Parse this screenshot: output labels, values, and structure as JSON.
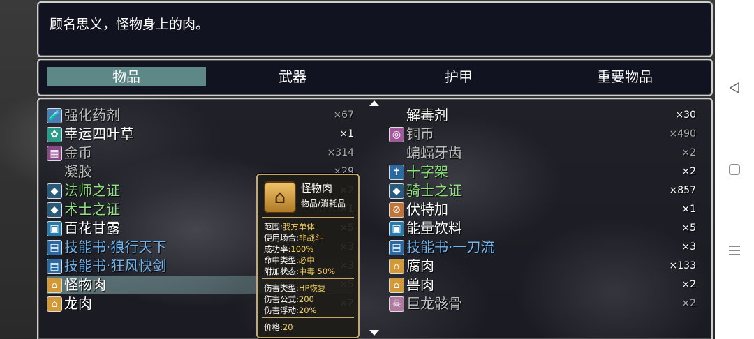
{
  "help_text": "顾名思义，怪物身上的肉。",
  "tabs": [
    {
      "label": "物品",
      "active": true
    },
    {
      "label": "武器",
      "active": false
    },
    {
      "label": "护甲",
      "active": false
    },
    {
      "label": "重要物品",
      "active": false
    }
  ],
  "items_left": [
    {
      "name": "强化药剂",
      "count": "×67",
      "icon": "potion-icon",
      "style": "dim"
    },
    {
      "name": "幸运四叶草",
      "count": "×1",
      "icon": "clover-icon",
      "style": ""
    },
    {
      "name": "金币",
      "count": "×314",
      "icon": "gold-coin-icon",
      "style": "dim"
    },
    {
      "name": "凝胶",
      "count": "×29",
      "icon": "",
      "style": "dim"
    },
    {
      "name": "法师之证",
      "count": "×2",
      "icon": "mage-badge-icon",
      "style": "green"
    },
    {
      "name": "术士之证",
      "count": "×1",
      "icon": "warlock-badge-icon",
      "style": "green"
    },
    {
      "name": "百花甘露",
      "count": "×5",
      "icon": "nectar-jar-icon",
      "style": ""
    },
    {
      "name": "技能书·狼行天下",
      "count": "×3",
      "icon": "skill-book-icon",
      "style": "blue"
    },
    {
      "name": "技能书·狂风快剑",
      "count": "×3",
      "icon": "skill-book-icon",
      "style": "blue"
    },
    {
      "name": "怪物肉",
      "count": "×5",
      "icon": "meat-icon",
      "style": ""
    },
    {
      "name": "龙肉",
      "count": "×2",
      "icon": "meat-icon",
      "style": ""
    }
  ],
  "items_right": [
    {
      "name": "解毒剂",
      "count": "×30",
      "icon": "",
      "style": ""
    },
    {
      "name": "铜币",
      "count": "×490",
      "icon": "copper-coin-icon",
      "style": "dim"
    },
    {
      "name": "蝙蝠牙齿",
      "count": "×2",
      "icon": "",
      "style": "dim"
    },
    {
      "name": "十字架",
      "count": "×2",
      "icon": "cross-icon",
      "style": "green"
    },
    {
      "name": "骑士之证",
      "count": "×857",
      "icon": "knight-badge-icon",
      "style": "green"
    },
    {
      "name": "伏特加",
      "count": "×1",
      "icon": "bottle-icon",
      "style": ""
    },
    {
      "name": "能量饮料",
      "count": "×5",
      "icon": "energy-drink-icon",
      "style": ""
    },
    {
      "name": "技能书·一刀流",
      "count": "×3",
      "icon": "skill-book-icon",
      "style": "blue"
    },
    {
      "name": "腐肉",
      "count": "×133",
      "icon": "meat-icon",
      "style": ""
    },
    {
      "name": "兽肉",
      "count": "×2",
      "icon": "meat-icon",
      "style": ""
    },
    {
      "name": "巨龙骸骨",
      "count": "×2",
      "icon": "dragon-bone-icon",
      "style": "dim"
    }
  ],
  "tooltip": {
    "name": "怪物肉",
    "type": "物品/消耗品",
    "lines": [
      {
        "label": "范围:",
        "value": "我方单体"
      },
      {
        "label": "使用场合:",
        "value": "非战斗"
      },
      {
        "label": "成功率:",
        "value": "100%"
      },
      {
        "label": "命中类型:",
        "value": "必中"
      },
      {
        "label": "附加状态:",
        "value": "中毒 50%"
      }
    ],
    "damage": [
      {
        "label": "伤害类型:",
        "value": "HP恢复"
      },
      {
        "label": "伤害公式:",
        "value": "200"
      },
      {
        "label": "伤害浮动:",
        "value": "20%"
      }
    ],
    "price_label": "价格:",
    "price": "20"
  },
  "colors": {
    "green_text": "#8fe07e",
    "blue_text": "#6fb6f0",
    "tab_active": "#78afaa",
    "tooltip_border": "#c8a86a"
  }
}
